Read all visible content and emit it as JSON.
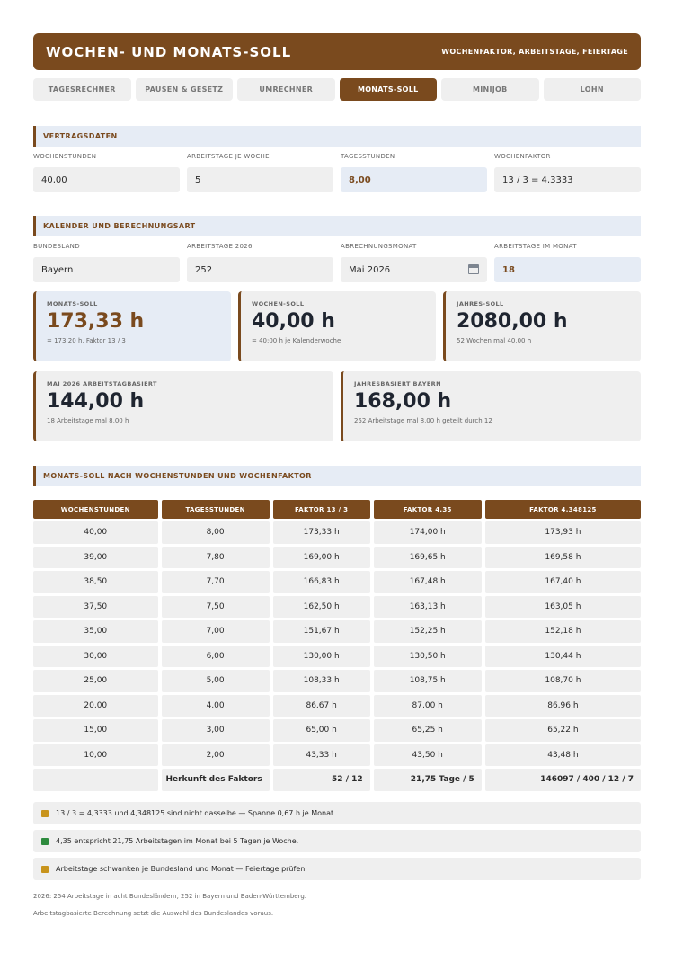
{
  "header": {
    "title": "WOCHEN- UND MONATS-SOLL",
    "subtitle": "WOCHENFAKTOR, ARBEITSTAGE, FEIERTAGE"
  },
  "tabs": [
    {
      "label": "TAGESRECHNER"
    },
    {
      "label": "PAUSEN & GESETZ"
    },
    {
      "label": "UMRECHNER"
    },
    {
      "label": "MONATS-SOLL",
      "active": true
    },
    {
      "label": "MINIJOB"
    },
    {
      "label": "LOHN"
    }
  ],
  "vertrag": {
    "title": "VERTRAGSDATEN",
    "fields": [
      {
        "label": "WOCHENSTUNDEN",
        "value": "40,00"
      },
      {
        "label": "ARBEITSTAGE JE WOCHE",
        "value": "5"
      },
      {
        "label": "TAGESSTUNDEN",
        "value": "8,00"
      },
      {
        "label": "WOCHENFAKTOR",
        "value": "13 / 3 = 4,3333"
      }
    ]
  },
  "kalender": {
    "title": "KALENDER UND BERECHNUNGSART",
    "fields": [
      {
        "label": "BUNDESLAND",
        "value": "Bayern"
      },
      {
        "label": "ARBEITSTAGE 2026",
        "value": "252"
      },
      {
        "label": "ABRECHNUNGSMONAT",
        "value": "Mai 2026"
      },
      {
        "label": "ARBEITSTAGE IM MONAT",
        "value": "18"
      }
    ]
  },
  "cards": {
    "monat": {
      "label": "MONATS-SOLL",
      "value": "173,33 h",
      "sub": "= 173:20 h, Faktor 13 / 3"
    },
    "woche": {
      "label": "WOCHEN-SOLL",
      "value": "40,00 h",
      "sub": "= 40:00 h je Kalenderwoche"
    },
    "jahr": {
      "label": "JAHRES-SOLL",
      "value": "2080,00 h",
      "sub": "52 Wochen mal 40,00 h"
    },
    "mai": {
      "label": "MAI 2026 ARBEITSTAGBASIERT",
      "value": "144,00 h",
      "sub": "18 Arbeitstage mal 8,00 h"
    },
    "bayern": {
      "label": "JAHRESBASIERT BAYERN",
      "value": "168,00 h",
      "sub": "252 Arbeitstage mal 8,00 h geteilt durch 12"
    }
  },
  "table": {
    "title": "MONATS-SOLL NACH WOCHENSTUNDEN UND WOCHENFAKTOR",
    "headers": [
      "WOCHENSTUNDEN",
      "TAGESSTUNDEN",
      "FAKTOR 13 / 3",
      "FAKTOR 4,35",
      "FAKTOR 4,348125"
    ],
    "rows": [
      [
        "40,00",
        "8,00",
        "173,33 h",
        "174,00 h",
        "173,93 h"
      ],
      [
        "39,00",
        "7,80",
        "169,00 h",
        "169,65 h",
        "169,58 h"
      ],
      [
        "38,50",
        "7,70",
        "166,83 h",
        "167,48 h",
        "167,40 h"
      ],
      [
        "37,50",
        "7,50",
        "162,50 h",
        "163,13 h",
        "163,05 h"
      ],
      [
        "35,00",
        "7,00",
        "151,67 h",
        "152,25 h",
        "152,18 h"
      ],
      [
        "30,00",
        "6,00",
        "130,00 h",
        "130,50 h",
        "130,44 h"
      ],
      [
        "25,00",
        "5,00",
        "108,33 h",
        "108,75 h",
        "108,70 h"
      ],
      [
        "20,00",
        "4,00",
        "86,67 h",
        "87,00 h",
        "86,96 h"
      ],
      [
        "15,00",
        "3,00",
        "65,00 h",
        "65,25 h",
        "65,22 h"
      ],
      [
        "10,00",
        "2,00",
        "43,33 h",
        "43,50 h",
        "43,48 h"
      ]
    ],
    "footer": {
      "label": "Herkunft des Faktors",
      "f1": "52 / 12",
      "f2": "21,75 Tage / 5",
      "f3": "146097 / 400 / 12 / 7"
    }
  },
  "notes": [
    {
      "text": "13 / 3 = 4,3333 und 4,348125 sind nicht dasselbe — Spanne 0,67 h je Monat.",
      "color": "#c8941c"
    },
    {
      "text": "4,35 entspricht 21,75 Arbeitstagen im Monat bei 5 Tagen je Woche.",
      "color": "#2e8b3e"
    },
    {
      "text": "Arbeitstage schwanken je Bundesland und Monat — Feiertage prüfen.",
      "color": "#c8941c"
    }
  ],
  "footnotes": [
    "2026: 254 Arbeitstage in acht Bundesländern, 252 in Bayern und Baden-Württemberg.",
    "Arbeitstagbasierte Berechnung setzt die Auswahl des Bundeslandes voraus."
  ]
}
